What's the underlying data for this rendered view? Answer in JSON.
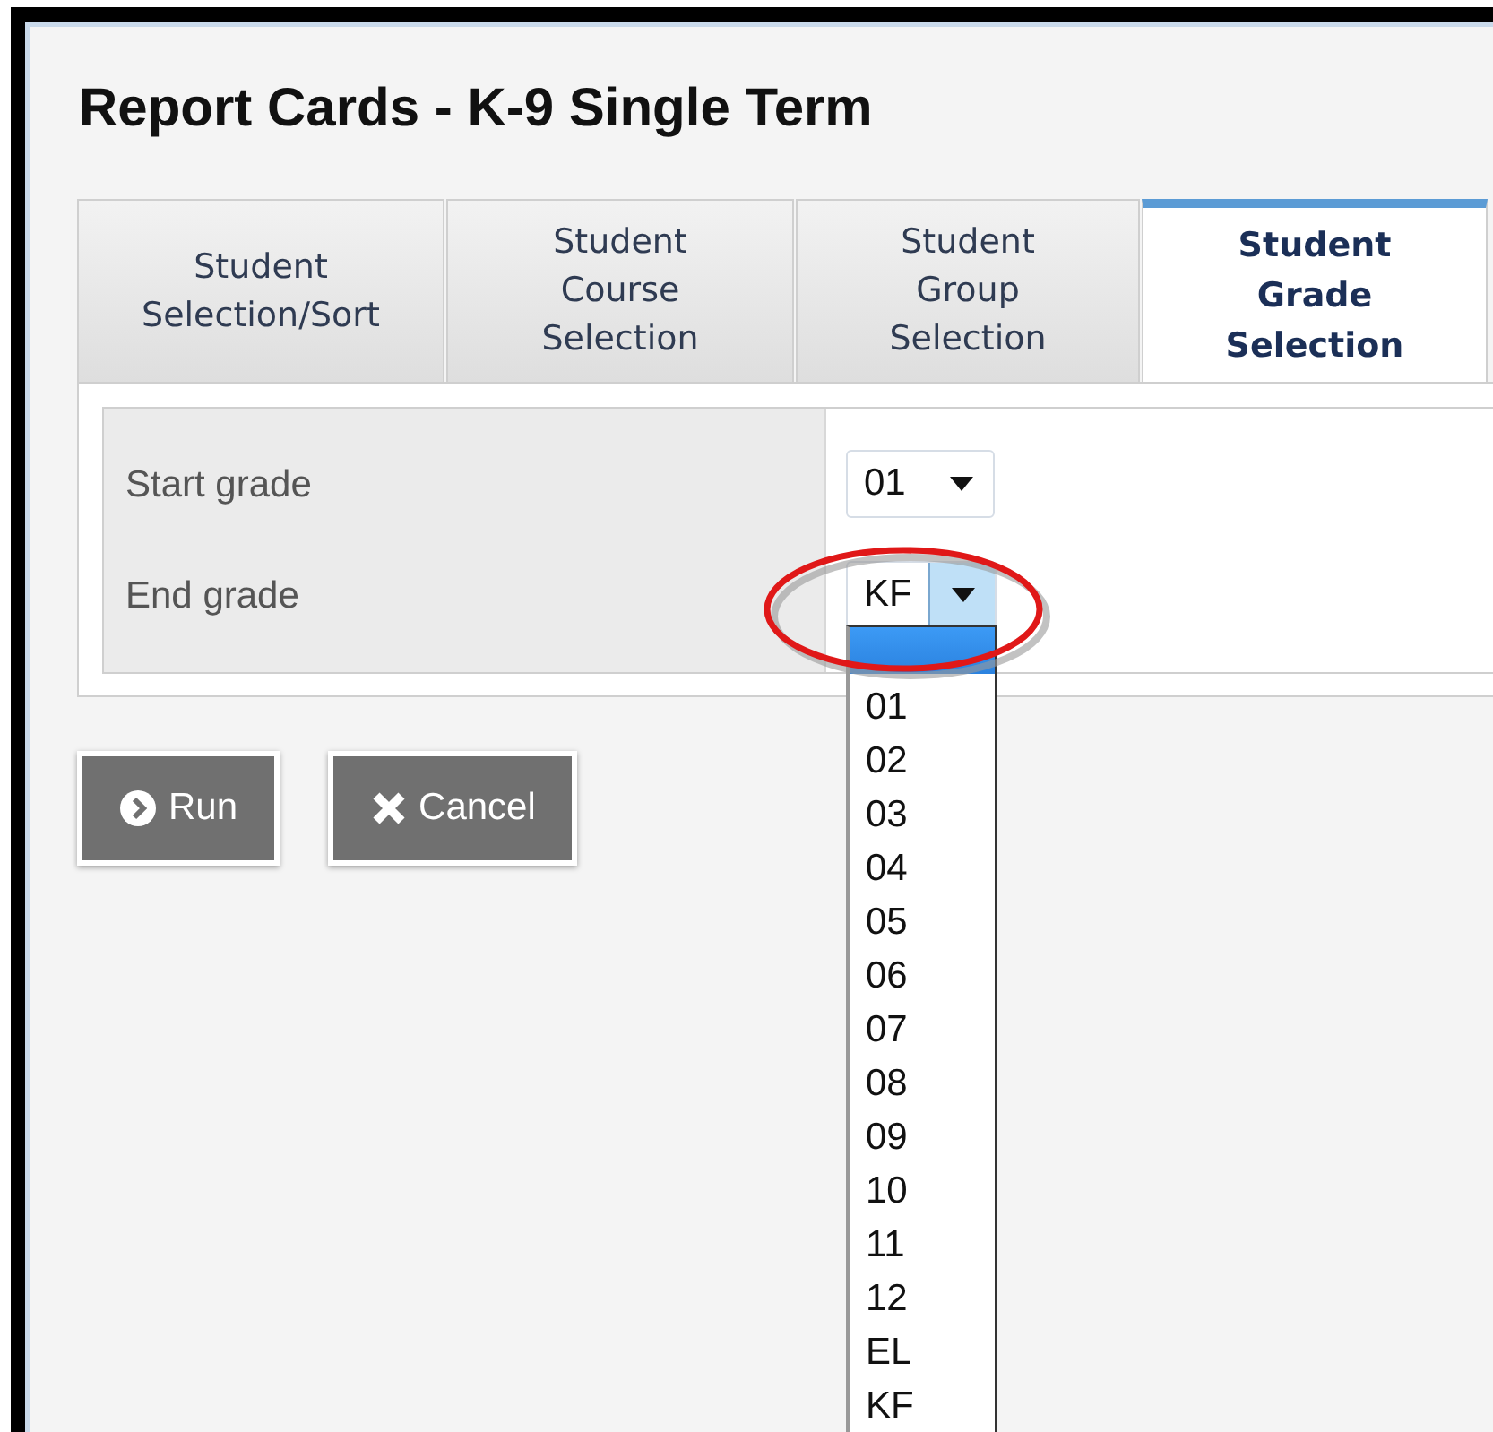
{
  "title": "Report Cards - K-9 Single Term",
  "tabs": [
    {
      "label": "Student\nSelection/Sort",
      "selected": false
    },
    {
      "label": "Student\nCourse\nSelection",
      "selected": false
    },
    {
      "label": "Student\nGroup\nSelection",
      "selected": false
    },
    {
      "label": "Student\nGrade\nSelection",
      "selected": true
    }
  ],
  "fields": [
    {
      "label": "Start grade",
      "value": "01",
      "open": false
    },
    {
      "label": "End grade",
      "value": "KF",
      "open": true,
      "annotated": true,
      "options": [
        {
          "highlighted": true
        },
        {
          "label": "01",
          "highlighted": false
        },
        {
          "label": "02",
          "highlighted": false
        },
        {
          "label": "03",
          "highlighted": false
        },
        {
          "label": "04",
          "highlighted": false
        },
        {
          "label": "05",
          "highlighted": false
        },
        {
          "label": "06",
          "highlighted": false
        },
        {
          "label": "07",
          "highlighted": false
        },
        {
          "label": "08",
          "highlighted": false
        },
        {
          "label": "09",
          "highlighted": false
        },
        {
          "label": "10",
          "highlighted": false
        },
        {
          "label": "11",
          "highlighted": false
        },
        {
          "label": "12",
          "highlighted": false
        },
        {
          "label": "EL",
          "highlighted": false
        },
        {
          "label": "KF",
          "highlighted": false
        }
      ]
    }
  ],
  "buttons": [
    {
      "label": "Run",
      "kind": "run"
    },
    {
      "label": "Cancel",
      "kind": "cancel"
    }
  ]
}
